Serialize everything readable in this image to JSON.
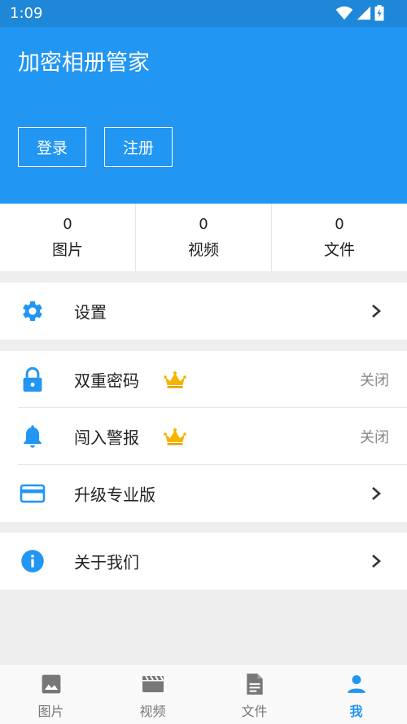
{
  "status_bar": {
    "time": "1:09",
    "wifi_icon": "wifi-icon",
    "signal_icon": "signal-icon",
    "battery_icon": "battery-charging-icon"
  },
  "header": {
    "title": "加密相册管家",
    "login_label": "登录",
    "register_label": "注册",
    "bg_color": "#2196f3"
  },
  "stats": [
    {
      "count": "0",
      "label": "图片"
    },
    {
      "count": "0",
      "label": "视频"
    },
    {
      "count": "0",
      "label": "文件"
    }
  ],
  "menu": {
    "settings": {
      "label": "设置",
      "icon": "gear-icon"
    },
    "double_password": {
      "label": "双重密码",
      "value": "关闭",
      "icon": "lock-icon",
      "premium_icon": "crown-icon"
    },
    "intrusion_alert": {
      "label": "闯入警报",
      "value": "关闭",
      "icon": "bell-icon",
      "premium_icon": "crown-icon"
    },
    "upgrade": {
      "label": "升级专业版",
      "icon": "credit-card-icon"
    },
    "about": {
      "label": "关于我们",
      "icon": "info-icon"
    }
  },
  "bottom_nav": [
    {
      "label": "图片",
      "icon": "image-icon",
      "active": false
    },
    {
      "label": "视频",
      "icon": "video-icon",
      "active": false
    },
    {
      "label": "文件",
      "icon": "file-icon",
      "active": false
    },
    {
      "label": "我",
      "icon": "person-icon",
      "active": true
    }
  ],
  "colors": {
    "accent": "#2196f3",
    "crown": "#f5b400",
    "muted": "#888888"
  }
}
